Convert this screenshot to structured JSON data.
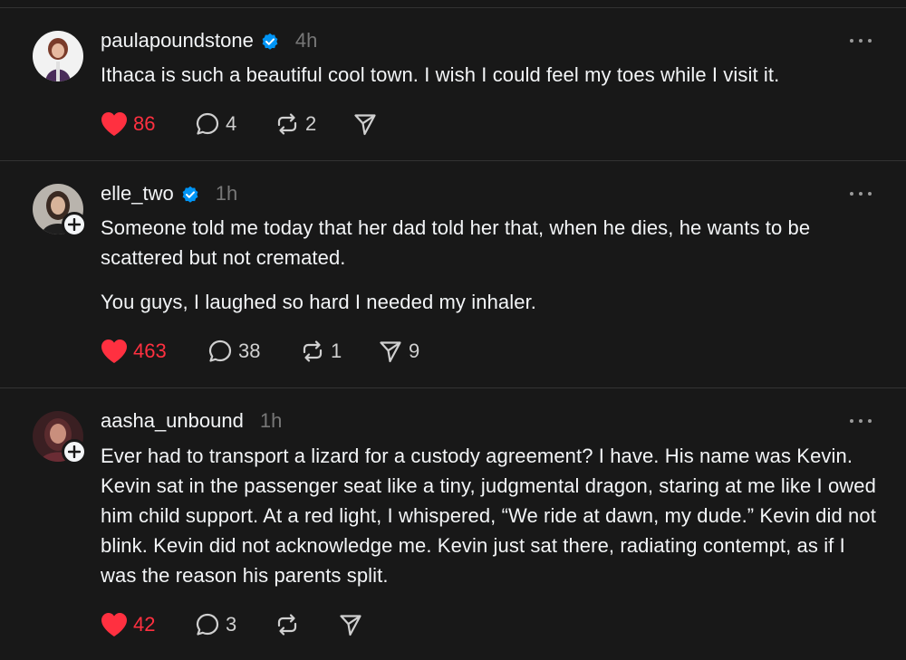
{
  "colors": {
    "background": "#181818",
    "divider": "#333333",
    "text_primary": "#f3f5f7",
    "text_secondary": "#777777",
    "like_red": "#ff3040",
    "verified_blue": "#0095f6"
  },
  "icons": {
    "like": "heart-filled-icon",
    "reply": "speech-bubble-icon",
    "repost": "repost-arrows-icon",
    "share": "paper-plane-icon",
    "more": "ellipsis-icon",
    "verified": "verified-badge-icon",
    "follow": "plus-icon"
  },
  "posts": [
    {
      "username": "paulapoundstone",
      "verified": true,
      "time": "4h",
      "show_follow": false,
      "paragraphs": [
        "Ithaca is such a beautiful cool town. I wish I could feel my toes while I visit it."
      ],
      "liked": true,
      "likes": "86",
      "replies": "4",
      "reposts": "2",
      "shares": ""
    },
    {
      "username": "elle_two",
      "verified": true,
      "time": "1h",
      "show_follow": true,
      "paragraphs": [
        "Someone told me today that her dad told her that, when he dies, he wants to be scattered but not cremated.",
        "You guys, I laughed so hard I needed my inhaler."
      ],
      "liked": true,
      "likes": "463",
      "replies": "38",
      "reposts": "1",
      "shares": "9"
    },
    {
      "username": "aasha_unbound",
      "verified": false,
      "time": "1h",
      "show_follow": true,
      "paragraphs": [
        "Ever had to transport a lizard for a custody agreement? I have. His name was Kevin. Kevin sat in the passenger seat like a tiny, judgmental dragon, staring at me like I owed him child support. At a red light, I whispered, “We ride at dawn, my dude.” Kevin did not blink. Kevin did not acknowledge me. Kevin just sat there, radiating contempt, as if I was the reason his parents split."
      ],
      "liked": true,
      "likes": "42",
      "replies": "3",
      "reposts": "",
      "shares": ""
    }
  ]
}
